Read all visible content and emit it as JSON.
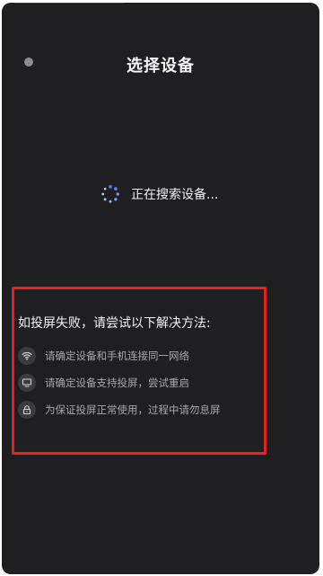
{
  "window": {
    "title": "选择设备"
  },
  "status": {
    "searching_text": "正在搜索设备..."
  },
  "tips": {
    "heading": "如投屏失败，请尝试以下解决方法:",
    "items": [
      {
        "icon": "wifi-icon",
        "text": "请确定设备和手机连接同一网络"
      },
      {
        "icon": "monitor-icon",
        "text": "请确定设备支持投屏，尝试重启"
      },
      {
        "icon": "lock-icon",
        "text": "为保证投屏正常使用，过程中请勿息屏"
      }
    ]
  },
  "colors": {
    "panel_background": "#1f1f21",
    "highlight_border": "#e52222",
    "spinner_accent": "#4a78f0"
  }
}
